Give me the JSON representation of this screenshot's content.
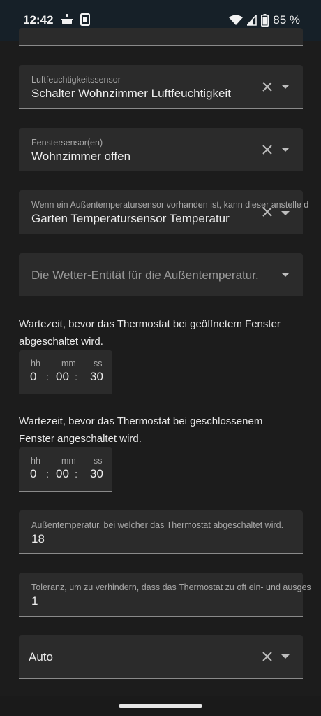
{
  "statusbar": {
    "time": "12:42",
    "battery": "85 %",
    "icons": [
      "cooking-pot-icon",
      "sim-card-icon",
      "wifi-icon",
      "signal-icon",
      "battery-icon"
    ]
  },
  "fields": {
    "humidity": {
      "label": "Luftfeuchtigkeitssensor",
      "value": "Schalter Wohnzimmer Luftfeuchtigkeit"
    },
    "window": {
      "label": "Fenstersensor(en)",
      "value": "Wohnzimmer offen"
    },
    "outdoor_temp": {
      "label": "Wenn ein Außentemperatursensor vorhanden ist, kann dieser anstelle d",
      "value": "Garten Temperatursensor Temperatur"
    },
    "weather": {
      "placeholder": "Die Wetter-Entität für die Außentemperatur."
    },
    "shutoff_temp": {
      "label": "Außentemperatur, bei welcher das Thermostat abgeschaltet wird.",
      "value": "18"
    },
    "tolerance": {
      "label": "Toleranz, um zu verhindern, dass das Thermostat zu oft ein- und ausges",
      "value": "1"
    },
    "mode": {
      "value": "Auto"
    }
  },
  "delays": {
    "open": {
      "description": " Wartezeit, bevor das Thermostat bei geöffnetem Fenster abgeschaltet wird.",
      "hh_label": "hh",
      "mm_label": "mm",
      "ss_label": "ss",
      "hh": "0",
      "mm": "00",
      "ss": "30",
      "sep": ":"
    },
    "closed": {
      "description": " Wartezeit, bevor das Thermostat bei geschlossenem Fenster angeschaltet wird.",
      "hh_label": "hh",
      "mm_label": "mm",
      "ss_label": "ss",
      "hh": "0",
      "mm": "00",
      "ss": "30",
      "sep": ":"
    }
  },
  "colors": {
    "background": "#1c1c1c",
    "field": "#2b2b2b",
    "statusbar": "#162028"
  }
}
